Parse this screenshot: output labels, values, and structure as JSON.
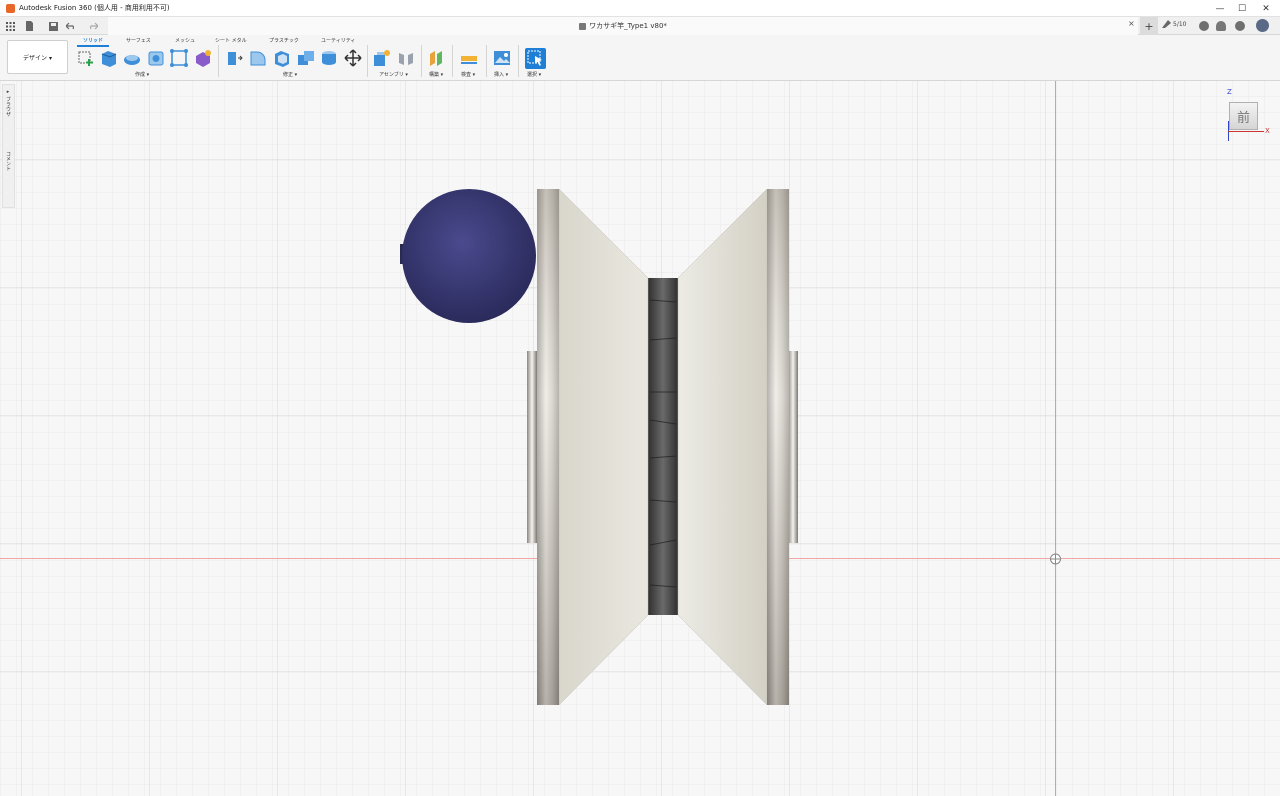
{
  "window": {
    "title": "Autodesk Fusion 360 (個人用 - 商用利用不可)",
    "minimize": "—",
    "maximize": "☐",
    "close": "✕"
  },
  "quickbar": {
    "doc_title": "ワカサギ竿_Type1 v80*",
    "tab_close": "×",
    "new_tab": "+",
    "jobs": "5/10",
    "icons": [
      "grid-icon",
      "file-icon",
      "save-icon",
      "undo-icon",
      "redo-icon",
      "help-icon",
      "bell-icon",
      "clock-icon",
      "avatar"
    ]
  },
  "toolbar": {
    "workspace_label": "デザイン ▾",
    "tabs": [
      "ソリッド",
      "サーフェス",
      "メッシュ",
      "シート メタル",
      "プラスチック",
      "ユーティリティ"
    ],
    "groups": {
      "create": "作成 ▾",
      "modify": "修正 ▾",
      "assemble": "アセンブリ ▾",
      "construct": "構築 ▾",
      "inspect": "検査 ▾",
      "insert": "挿入 ▾",
      "select": "選択 ▾"
    },
    "accent": "#1e7fd6"
  },
  "browser": {
    "toggle_label": "▸ ブラウザ",
    "comments_label": "コメント"
  },
  "viewcube": {
    "face": "前",
    "axis_z": "Z",
    "axis_x": "X"
  },
  "model": {
    "sphere_color": "#3a3a78",
    "body_color": "#e3e1d8",
    "flange_color": "#c9c5bb"
  }
}
